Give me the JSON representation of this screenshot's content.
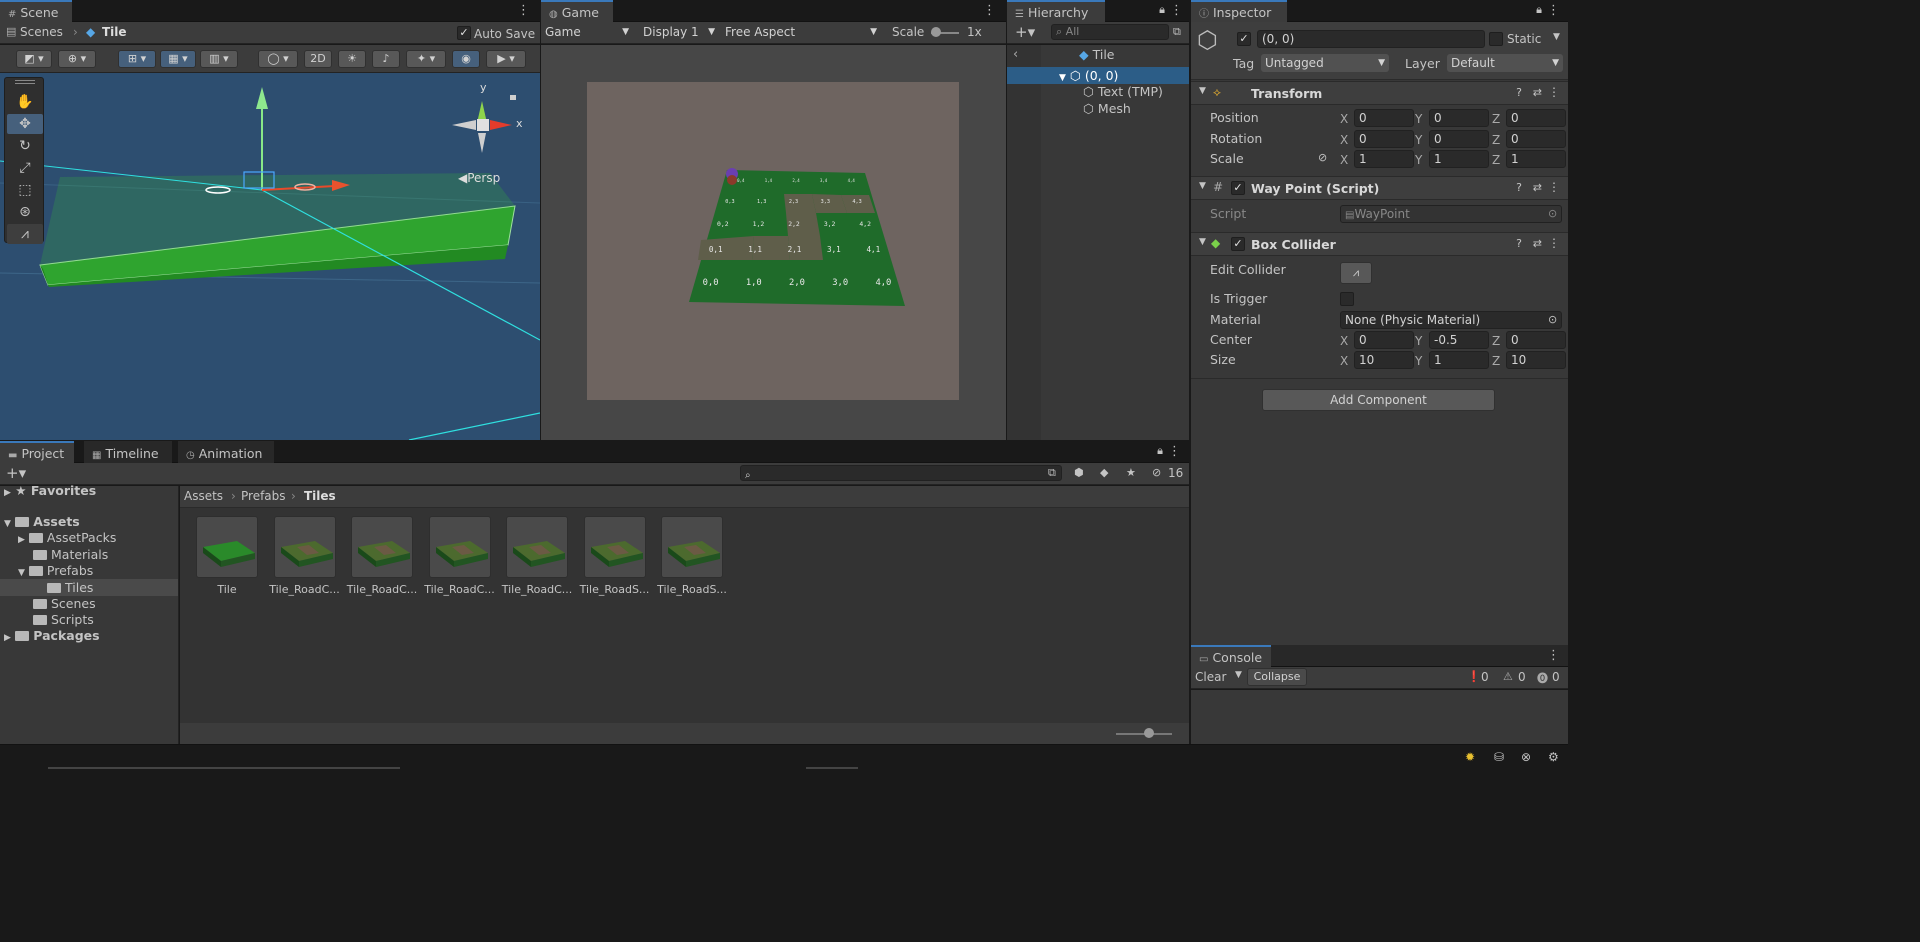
{
  "scene": {
    "tab": "Scene",
    "breadcrumb_root": "Scenes",
    "breadcrumb_item": "Tile",
    "auto_save": "Auto Save",
    "toggle_2d": "2D",
    "persp": "Persp",
    "gizmo_x": "x",
    "gizmo_y": "y"
  },
  "game": {
    "tab": "Game",
    "mode": "Game",
    "display": "Display 1",
    "aspect": "Free Aspect",
    "scale_label": "Scale",
    "scale_value": "1x",
    "tile_labels": [
      [
        "0,4",
        "1,4",
        "2,4",
        "3,4",
        "4,4"
      ],
      [
        "0,3",
        "1,3",
        "2,3",
        "3,3",
        "4,3"
      ],
      [
        "0,2",
        "1,2",
        "2,2",
        "3,2",
        "4,2"
      ],
      [
        "0,1",
        "1,1",
        "2,1",
        "3,1",
        "4,1"
      ],
      [
        "0,0",
        "1,0",
        "2,0",
        "3,0",
        "4,0"
      ]
    ]
  },
  "hierarchy": {
    "tab": "Hierarchy",
    "search_placeholder": "All",
    "root": "Tile",
    "selected": "(0, 0)",
    "children": [
      "Text (TMP)",
      "Mesh"
    ]
  },
  "inspector": {
    "tab": "Inspector",
    "object_name": "(0, 0)",
    "static": "Static",
    "tag_label": "Tag",
    "tag_value": "Untagged",
    "layer_label": "Layer",
    "layer_value": "Default",
    "transform": {
      "title": "Transform",
      "position_label": "Position",
      "rotation_label": "Rotation",
      "scale_label": "Scale",
      "position": [
        "0",
        "0",
        "0"
      ],
      "rotation": [
        "0",
        "0",
        "0"
      ],
      "scale": [
        "1",
        "1",
        "1"
      ]
    },
    "waypoint": {
      "title": "Way Point (Script)",
      "script_label": "Script",
      "script_value": "WayPoint"
    },
    "box_collider": {
      "title": "Box Collider",
      "edit_collider": "Edit Collider",
      "is_trigger": "Is Trigger",
      "material_label": "Material",
      "material_value": "None (Physic Material)",
      "center_label": "Center",
      "size_label": "Size",
      "center": [
        "0",
        "-0.5",
        "0"
      ],
      "size": [
        "10",
        "1",
        "10"
      ]
    },
    "axes": [
      "X",
      "Y",
      "Z"
    ],
    "add_component": "Add Component"
  },
  "project": {
    "tabs": [
      "Project",
      "Timeline",
      "Animation"
    ],
    "hidden_count": "16",
    "breadcrumb": [
      "Assets",
      "Prefabs",
      "Tiles"
    ],
    "tree": {
      "favorites": "Favorites",
      "assets": "Assets",
      "asset_packs": "AssetPacks",
      "materials": "Materials",
      "prefabs": "Prefabs",
      "tiles": "Tiles",
      "scenes": "Scenes",
      "scripts": "Scripts",
      "packages": "Packages"
    },
    "assets": [
      "Tile",
      "Tile_RoadC...",
      "Tile_RoadC...",
      "Tile_RoadC...",
      "Tile_RoadC...",
      "Tile_RoadS...",
      "Tile_RoadS..."
    ]
  },
  "console": {
    "tab": "Console",
    "clear": "Clear",
    "collapse": "Collapse",
    "log_count": "0",
    "warn_count": "0",
    "error_count": "0"
  }
}
